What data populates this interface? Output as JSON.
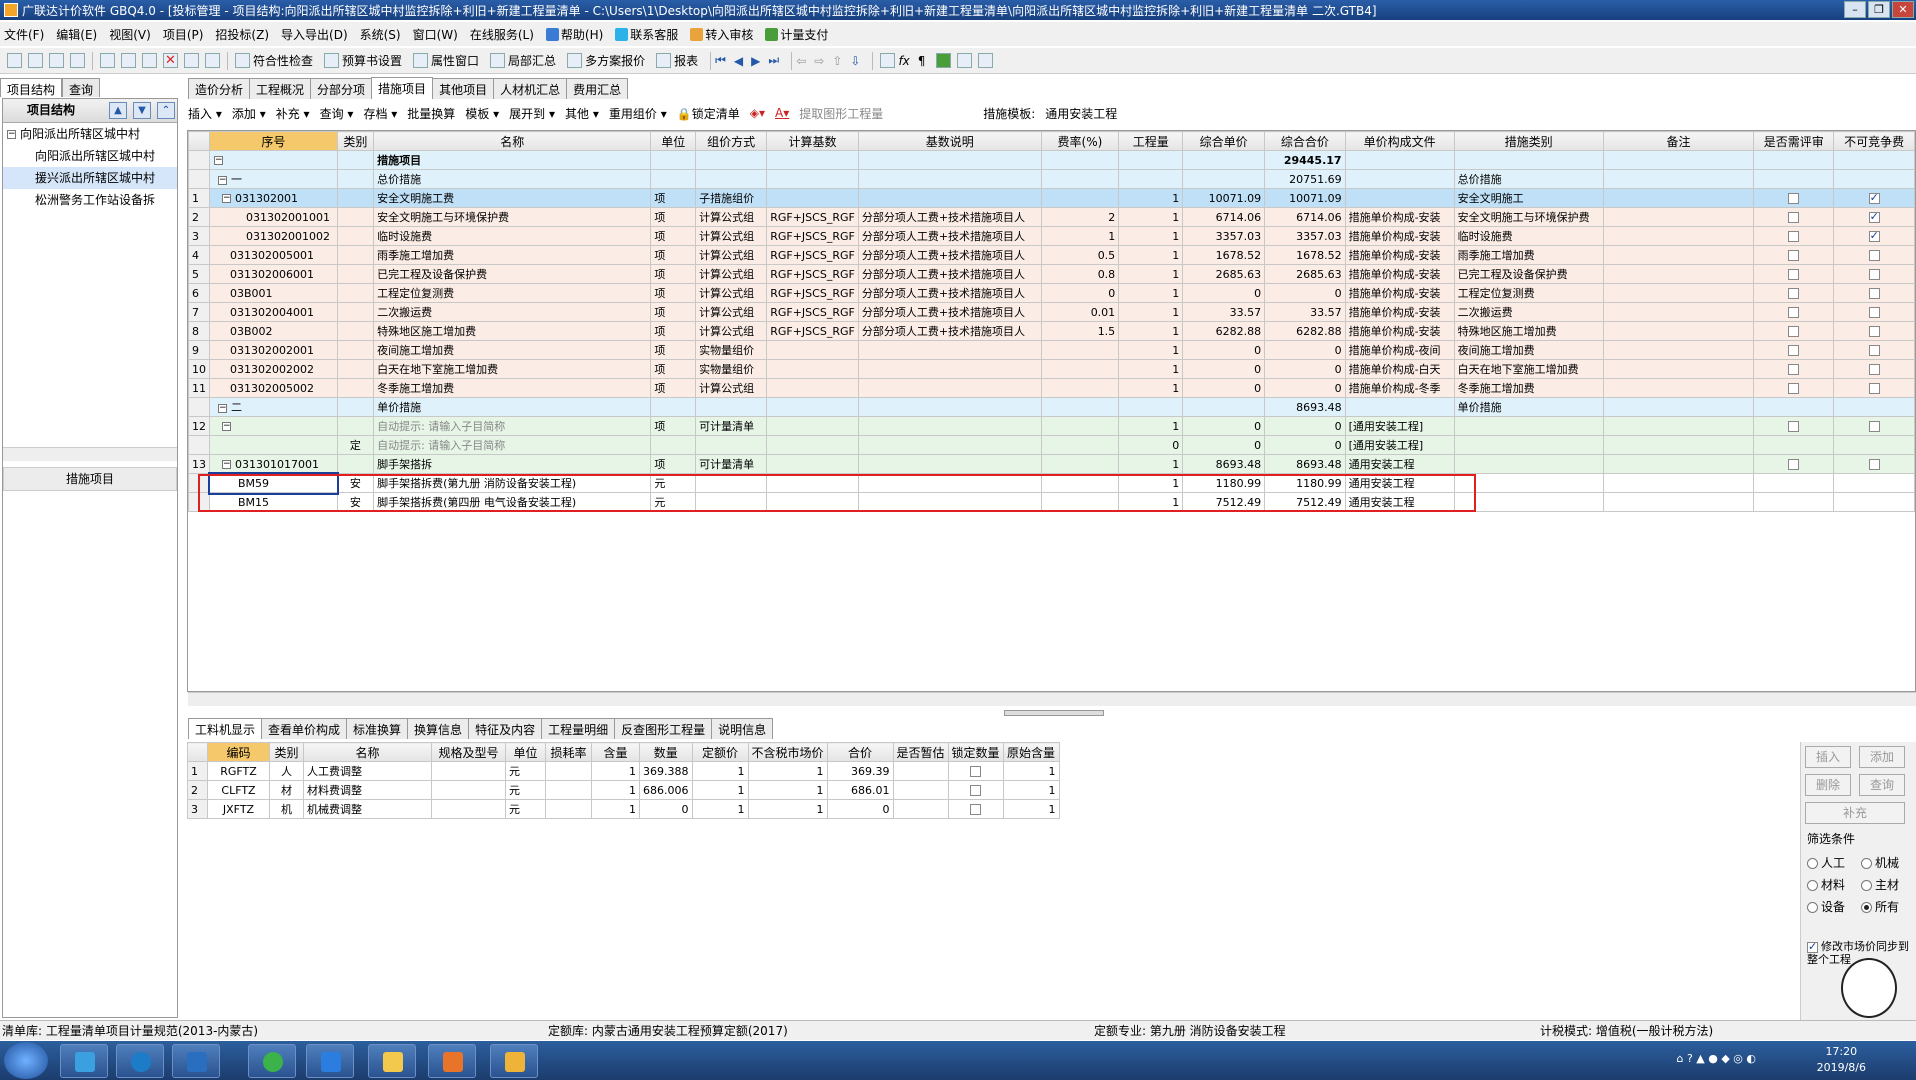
{
  "window": {
    "title": "广联达计价软件 GBQ4.0 - [投标管理 - 项目结构:向阳派出所辖区城中村监控拆除+利旧+新建工程量清单 - C:\\Users\\1\\Desktop\\向阳派出所辖区城中村监控拆除+利旧+新建工程量清单\\向阳派出所辖区城中村监控拆除+利旧+新建工程量清单 二次.GTB4]"
  },
  "menu": [
    "文件(F)",
    "编辑(E)",
    "视图(V)",
    "项目(P)",
    "招投标(Z)",
    "导入导出(D)",
    "系统(S)",
    "窗口(W)",
    "在线服务(L)",
    "帮助(H)",
    "联系客服",
    "转入审核",
    "计量支付"
  ],
  "toolbar": {
    "check": "符合性检查",
    "budget": "预算书设置",
    "attr": "属性窗口",
    "summary": "局部汇总",
    "multi": "多方案报价",
    "report": "报表"
  },
  "left": {
    "tabs": [
      "项目结构",
      "查询"
    ],
    "header": "项目结构",
    "tree": [
      "向阳派出所辖区城中村",
      "向阳派出所辖区城中村",
      "援兴派出所辖区城中村",
      "松洲警务工作站设备拆"
    ],
    "bottom": "措施项目"
  },
  "tabs": [
    "造价分析",
    "工程概况",
    "分部分项",
    "措施项目",
    "其他项目",
    "人材机汇总",
    "费用汇总"
  ],
  "subtool": {
    "items": [
      "插入",
      "添加",
      "补充",
      "查询",
      "存档",
      "批量换算",
      "模板",
      "展开到",
      "其他",
      "重用组价",
      "锁定清单",
      "提取图形工程量"
    ],
    "template_label": "措施模板:",
    "template_value": "通用安装工程"
  },
  "columns": [
    "序号",
    "类别",
    "名称",
    "单位",
    "组价方式",
    "计算基数",
    "基数说明",
    "费率(%)",
    "工程量",
    "综合单价",
    "综合合价",
    "单价构成文件",
    "措施类别",
    "备注",
    "是否需评审",
    "不可竞争费"
  ],
  "rows": [
    {
      "no": "",
      "code": "",
      "type": "",
      "name": "措施项目",
      "unit": "",
      "method": "",
      "base": "",
      "desc": "",
      "rate": "",
      "qty": "",
      "price": "",
      "total": "29445.17",
      "file": "",
      "cat": "",
      "c1": "",
      "c2": ""
    },
    {
      "no": "",
      "code": "一",
      "type": "",
      "name": "总价措施",
      "unit": "",
      "method": "",
      "base": "",
      "desc": "",
      "rate": "",
      "qty": "",
      "price": "",
      "total": "20751.69",
      "file": "",
      "cat": "总价措施",
      "c1": "",
      "c2": ""
    },
    {
      "no": "1",
      "code": "031302001",
      "type": "",
      "name": "安全文明施工费",
      "unit": "项",
      "method": "子措施组价",
      "base": "",
      "desc": "",
      "rate": "",
      "qty": "1",
      "price": "10071.09",
      "total": "10071.09",
      "file": "",
      "cat": "安全文明施工",
      "c1": "off",
      "c2": "on"
    },
    {
      "no": "2",
      "code": "031302001001",
      "type": "",
      "name": "安全文明施工与环境保护费",
      "unit": "项",
      "method": "计算公式组",
      "base": "RGF+JSCS_RGF",
      "desc": "分部分项人工费+技术措施项目人",
      "rate": "2",
      "qty": "1",
      "price": "6714.06",
      "total": "6714.06",
      "file": "措施单价构成-安装",
      "cat": "安全文明施工与环境保护费",
      "c1": "off",
      "c2": "on"
    },
    {
      "no": "3",
      "code": "031302001002",
      "type": "",
      "name": "临时设施费",
      "unit": "项",
      "method": "计算公式组",
      "base": "RGF+JSCS_RGF",
      "desc": "分部分项人工费+技术措施项目人",
      "rate": "1",
      "qty": "1",
      "price": "3357.03",
      "total": "3357.03",
      "file": "措施单价构成-安装",
      "cat": "临时设施费",
      "c1": "off",
      "c2": "on"
    },
    {
      "no": "4",
      "code": "031302005001",
      "type": "",
      "name": "雨季施工增加费",
      "unit": "项",
      "method": "计算公式组",
      "base": "RGF+JSCS_RGF",
      "desc": "分部分项人工费+技术措施项目人",
      "rate": "0.5",
      "qty": "1",
      "price": "1678.52",
      "total": "1678.52",
      "file": "措施单价构成-安装",
      "cat": "雨季施工增加费",
      "c1": "off",
      "c2": "off"
    },
    {
      "no": "5",
      "code": "031302006001",
      "type": "",
      "name": "已完工程及设备保护费",
      "unit": "项",
      "method": "计算公式组",
      "base": "RGF+JSCS_RGF",
      "desc": "分部分项人工费+技术措施项目人",
      "rate": "0.8",
      "qty": "1",
      "price": "2685.63",
      "total": "2685.63",
      "file": "措施单价构成-安装",
      "cat": "已完工程及设备保护费",
      "c1": "off",
      "c2": "off"
    },
    {
      "no": "6",
      "code": "03B001",
      "type": "",
      "name": "工程定位复测费",
      "unit": "项",
      "method": "计算公式组",
      "base": "RGF+JSCS_RGF",
      "desc": "分部分项人工费+技术措施项目人",
      "rate": "0",
      "qty": "1",
      "price": "0",
      "total": "0",
      "file": "措施单价构成-安装",
      "cat": "工程定位复测费",
      "c1": "off",
      "c2": "off"
    },
    {
      "no": "7",
      "code": "031302004001",
      "type": "",
      "name": "二次搬运费",
      "unit": "项",
      "method": "计算公式组",
      "base": "RGF+JSCS_RGF",
      "desc": "分部分项人工费+技术措施项目人",
      "rate": "0.01",
      "qty": "1",
      "price": "33.57",
      "total": "33.57",
      "file": "措施单价构成-安装",
      "cat": "二次搬运费",
      "c1": "off",
      "c2": "off"
    },
    {
      "no": "8",
      "code": "03B002",
      "type": "",
      "name": "特殊地区施工增加费",
      "unit": "项",
      "method": "计算公式组",
      "base": "RGF+JSCS_RGF",
      "desc": "分部分项人工费+技术措施项目人",
      "rate": "1.5",
      "qty": "1",
      "price": "6282.88",
      "total": "6282.88",
      "file": "措施单价构成-安装",
      "cat": "特殊地区施工增加费",
      "c1": "off",
      "c2": "off"
    },
    {
      "no": "9",
      "code": "031302002001",
      "type": "",
      "name": "夜间施工增加费",
      "unit": "项",
      "method": "实物量组价",
      "base": "",
      "desc": "",
      "rate": "",
      "qty": "1",
      "price": "0",
      "total": "0",
      "file": "措施单价构成-夜间",
      "cat": "夜间施工增加费",
      "c1": "off",
      "c2": "off"
    },
    {
      "no": "10",
      "code": "031302002002",
      "type": "",
      "name": "白天在地下室施工增加费",
      "unit": "项",
      "method": "实物量组价",
      "base": "",
      "desc": "",
      "rate": "",
      "qty": "1",
      "price": "0",
      "total": "0",
      "file": "措施单价构成-白天",
      "cat": "白天在地下室施工增加费",
      "c1": "off",
      "c2": "off"
    },
    {
      "no": "11",
      "code": "031302005002",
      "type": "",
      "name": "冬季施工增加费",
      "unit": "项",
      "method": "计算公式组",
      "base": "",
      "desc": "",
      "rate": "",
      "qty": "1",
      "price": "0",
      "total": "0",
      "file": "措施单价构成-冬季",
      "cat": "冬季施工增加费",
      "c1": "off",
      "c2": "off"
    },
    {
      "no": "",
      "code": "二",
      "type": "",
      "name": "单价措施",
      "unit": "",
      "method": "",
      "base": "",
      "desc": "",
      "rate": "",
      "qty": "",
      "price": "",
      "total": "8693.48",
      "file": "",
      "cat": "单价措施",
      "c1": "",
      "c2": ""
    },
    {
      "no": "12",
      "code": "",
      "type": "",
      "name": "自动提示: 请输入子目简称",
      "unit": "项",
      "method": "可计量清单",
      "base": "",
      "desc": "",
      "rate": "",
      "qty": "1",
      "price": "0",
      "total": "0",
      "file": "[通用安装工程]",
      "cat": "",
      "c1": "off",
      "c2": "off"
    },
    {
      "no": "",
      "code": "",
      "type": "定",
      "name": "自动提示: 请输入子目简称",
      "unit": "",
      "method": "",
      "base": "",
      "desc": "",
      "rate": "",
      "qty": "0",
      "price": "0",
      "total": "0",
      "file": "[通用安装工程]",
      "cat": "",
      "c1": "",
      "c2": ""
    },
    {
      "no": "13",
      "code": "031301017001",
      "type": "",
      "name": "脚手架搭拆",
      "unit": "项",
      "method": "可计量清单",
      "base": "",
      "desc": "",
      "rate": "",
      "qty": "1",
      "price": "8693.48",
      "total": "8693.48",
      "file": "通用安装工程",
      "cat": "",
      "c1": "off",
      "c2": "off"
    },
    {
      "no": "",
      "code": "BM59",
      "type": "安",
      "name": "脚手架搭拆费(第九册 消防设备安装工程)",
      "unit": "元",
      "method": "",
      "base": "",
      "desc": "",
      "rate": "",
      "qty": "1",
      "price": "1180.99",
      "total": "1180.99",
      "file": "通用安装工程",
      "cat": "",
      "c1": "",
      "c2": ""
    },
    {
      "no": "",
      "code": "BM15",
      "type": "安",
      "name": "脚手架搭拆费(第四册 电气设备安装工程)",
      "unit": "元",
      "method": "",
      "base": "",
      "desc": "",
      "rate": "",
      "qty": "1",
      "price": "7512.49",
      "total": "7512.49",
      "file": "通用安装工程",
      "cat": "",
      "c1": "",
      "c2": ""
    }
  ],
  "bottom_tabs": [
    "工料机显示",
    "查看单价构成",
    "标准换算",
    "换算信息",
    "特征及内容",
    "工程量明细",
    "反查图形工程量",
    "说明信息"
  ],
  "bottom_columns": [
    "编码",
    "类别",
    "名称",
    "规格及型号",
    "单位",
    "损耗率",
    "含量",
    "数量",
    "定额价",
    "不含税市场价",
    "合价",
    "是否暂估",
    "锁定数量",
    "原始含量"
  ],
  "bottom_rows": [
    {
      "no": "1",
      "code": "RGFTZ",
      "type": "人",
      "name": "人工费调整",
      "spec": "",
      "unit": "元",
      "loss": "",
      "content": "1",
      "qty": "369.388",
      "price": "1",
      "market": "1",
      "total": "369.39",
      "orig": "1"
    },
    {
      "no": "2",
      "code": "CLFTZ",
      "type": "材",
      "name": "材料费调整",
      "spec": "",
      "unit": "元",
      "loss": "",
      "content": "1",
      "qty": "686.006",
      "price": "1",
      "market": "1",
      "total": "686.01",
      "orig": "1"
    },
    {
      "no": "3",
      "code": "JXFTZ",
      "type": "机",
      "name": "机械费调整",
      "spec": "",
      "unit": "元",
      "loss": "",
      "content": "1",
      "qty": "0",
      "price": "1",
      "market": "1",
      "total": "0",
      "orig": "1"
    }
  ],
  "right": {
    "insert": "插入",
    "add": "添加",
    "delete": "删除",
    "query": "查询",
    "supplement": "补充",
    "filter": "筛选条件",
    "r1": "人工",
    "r2": "机械",
    "r3": "材料",
    "r4": "主材",
    "r5": "设备",
    "r6": "所有",
    "sync": "修改市场价同步到整个工程"
  },
  "status": {
    "list": "清单库: 工程量清单项目计量规范(2013-内蒙古)",
    "quota": "定额库: 内蒙古通用安装工程预算定额(2017)",
    "major": "定额专业: 第九册 消防设备安装工程",
    "tax": "计税模式: 增值税(一般计税方法)"
  },
  "clock": {
    "time": "17:20",
    "date": "2019/8/6"
  }
}
